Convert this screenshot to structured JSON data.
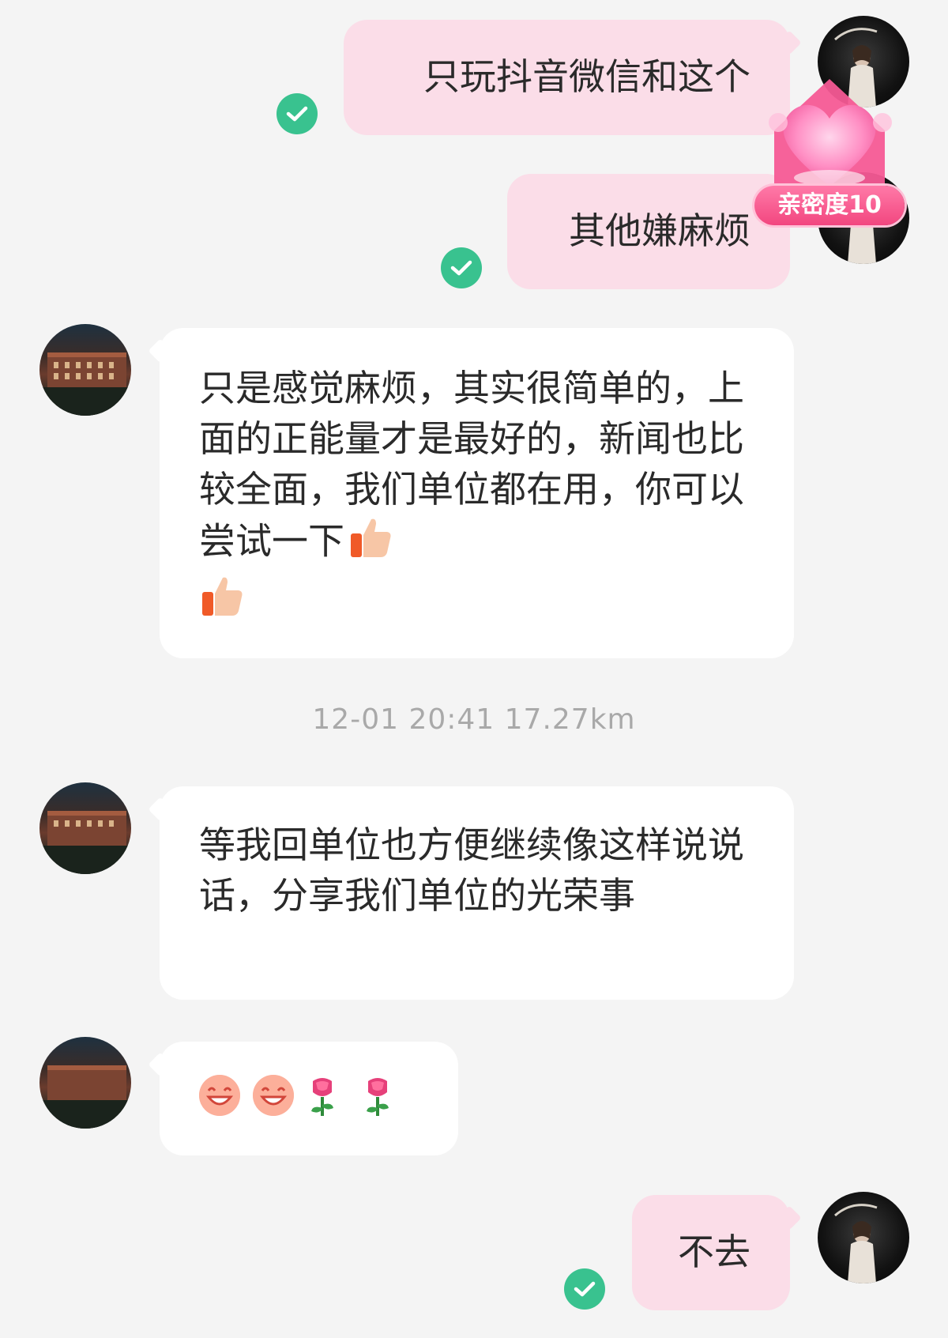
{
  "messages": [
    {
      "text": "只玩抖音微信和这个"
    },
    {
      "text": "其他嫌麻烦"
    },
    {
      "text": "只是感觉麻烦，其实很简单的，上面的正能量才是最好的，新闻也比较全面，我们单位都在用，你可以尝试一下"
    },
    {
      "text": "等我回单位也方便继续像这样说说话，分享我们单位的光荣事"
    },
    {
      "text": "不去"
    }
  ],
  "timestamp": "12-01 20:41  17.27km",
  "intimacy_badge": "亲密度10",
  "icons": {
    "thumbs_up": "thumbs-up-icon",
    "grin": "grin-face-icon",
    "rose": "rose-icon",
    "read_check": "check-icon"
  },
  "colors": {
    "out_bubble": "#fbdde8",
    "in_bubble": "#ffffff",
    "read_check": "#39c28f",
    "badge": "#f2467f",
    "background": "#f4f4f4"
  }
}
